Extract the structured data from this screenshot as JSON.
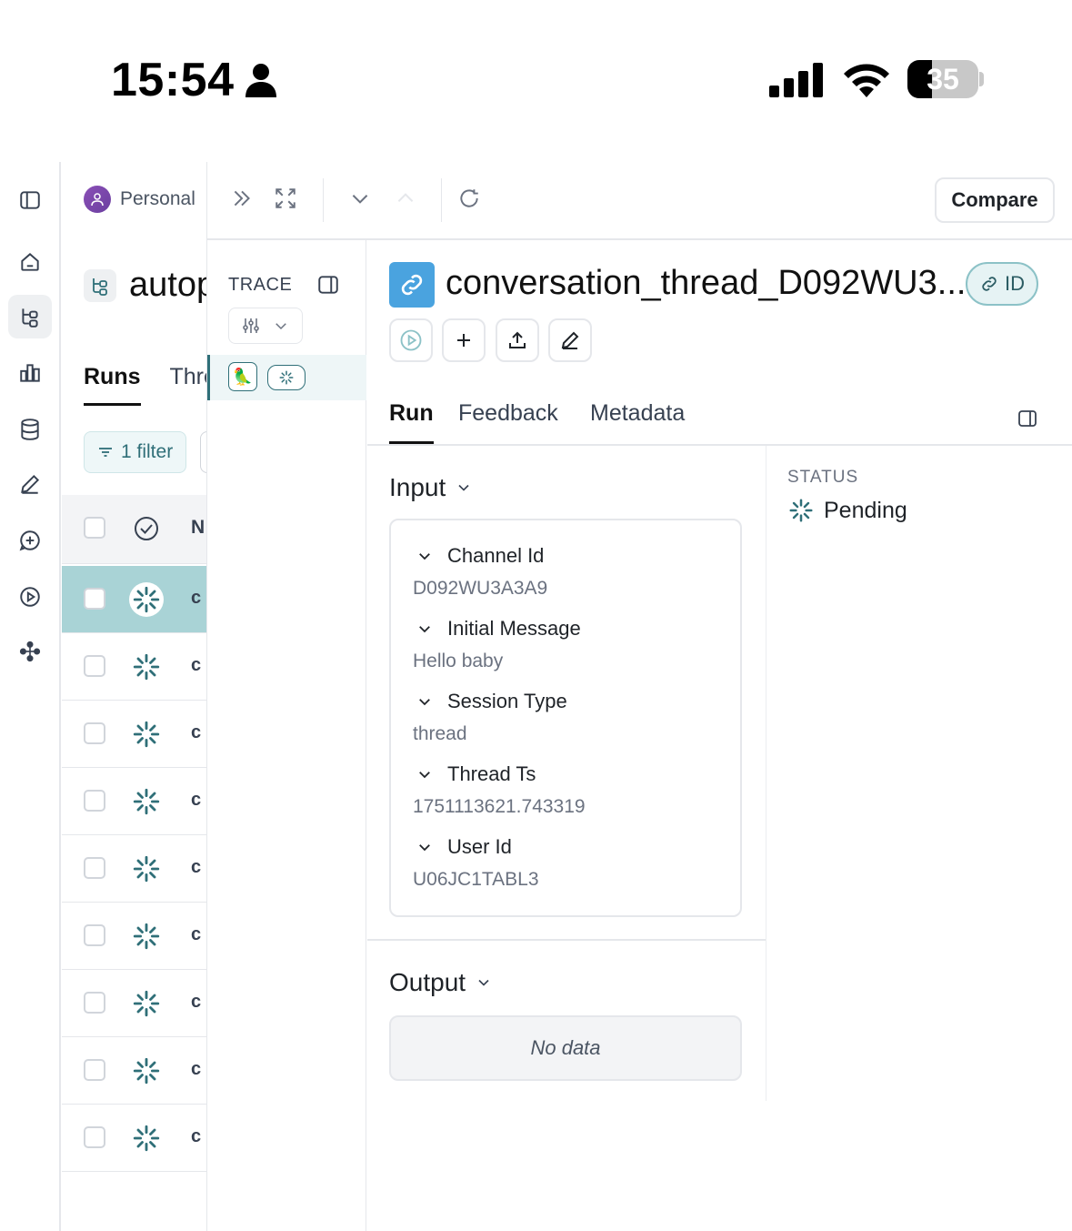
{
  "status_bar": {
    "time": "15:54",
    "battery_percent": "35",
    "battery_level": 0.35
  },
  "rail": {
    "items": [
      {
        "icon": "sidebar-toggle-icon"
      },
      {
        "icon": "home-icon"
      },
      {
        "icon": "tracing-projects-icon",
        "active": true
      },
      {
        "icon": "dashboards-icon"
      },
      {
        "icon": "datasets-icon"
      },
      {
        "icon": "annotation-icon"
      },
      {
        "icon": "prompts-icon"
      },
      {
        "icon": "playground-icon"
      },
      {
        "icon": "deployments-icon"
      }
    ]
  },
  "runs_page": {
    "workspace": "Personal",
    "project_name": "autop",
    "tabs": [
      "Runs",
      "Thre"
    ],
    "filter_label": "1 filter",
    "column_name_header": "N",
    "rows": [
      {
        "name": "c",
        "status": "pending",
        "selected": true
      },
      {
        "name": "c",
        "status": "pending"
      },
      {
        "name": "c",
        "status": "pending"
      },
      {
        "name": "c",
        "status": "pending"
      },
      {
        "name": "c",
        "status": "pending"
      },
      {
        "name": "c",
        "status": "pending"
      },
      {
        "name": "c",
        "status": "pending"
      },
      {
        "name": "c",
        "status": "pending"
      },
      {
        "name": "c",
        "status": "pending"
      }
    ]
  },
  "panel": {
    "compare_label": "Compare",
    "trace": {
      "label": "TRACE",
      "node_emoji": "🦜"
    },
    "run": {
      "title": "conversation_thread_D092WU3...",
      "id_label": "ID",
      "tabs": [
        "Run",
        "Feedback",
        "Metadata"
      ],
      "active_tab": "Run"
    },
    "input": {
      "title": "Input",
      "fields": [
        {
          "key": "Channel Id",
          "value": "D092WU3A3A9"
        },
        {
          "key": "Initial Message",
          "value": "Hello baby"
        },
        {
          "key": "Session Type",
          "value": "thread"
        },
        {
          "key": "Thread Ts",
          "value": "1751113621.743319"
        },
        {
          "key": "User Id",
          "value": "U06JC1TABL3"
        }
      ]
    },
    "output": {
      "title": "Output",
      "empty_text": "No data"
    },
    "status": {
      "label": "STATUS",
      "value": "Pending"
    }
  },
  "colors": {
    "accent_teal": "#2f6f78",
    "selected_row": "#a9d3d6",
    "run_icon_blue": "#4aa3df",
    "workspace_avatar": "#7a45ad"
  }
}
